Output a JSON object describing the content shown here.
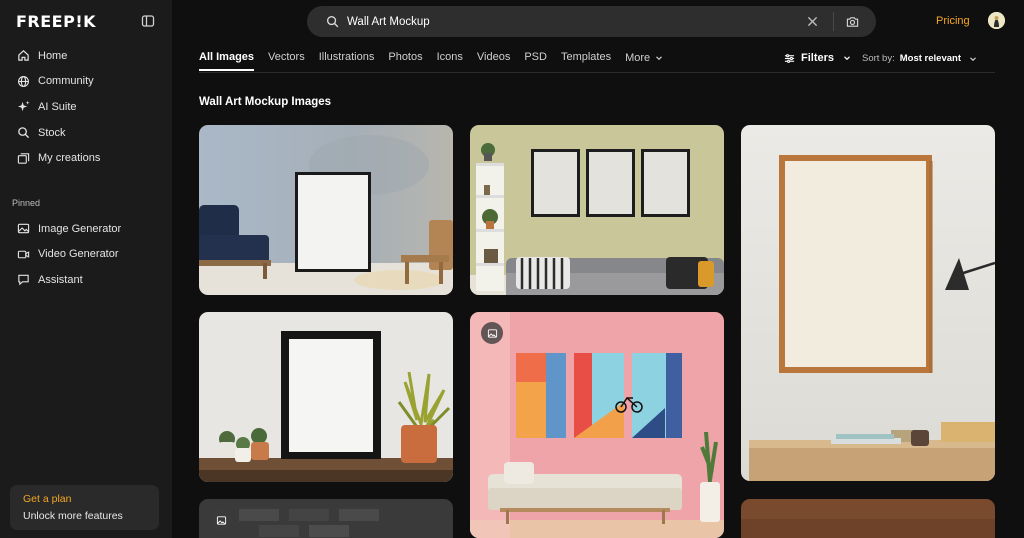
{
  "brand": {
    "logo_text": "FREEP!K"
  },
  "sidebar": {
    "items": [
      {
        "label": "Home",
        "icon": "home-icon"
      },
      {
        "label": "Community",
        "icon": "globe-icon"
      },
      {
        "label": "AI Suite",
        "icon": "sparkle-icon"
      },
      {
        "label": "Stock",
        "icon": "search-icon"
      },
      {
        "label": "My creations",
        "icon": "gallery-icon"
      }
    ],
    "pinned_label": "Pinned",
    "pinned": [
      {
        "label": "Image Generator",
        "icon": "image-icon"
      },
      {
        "label": "Video Generator",
        "icon": "video-icon"
      },
      {
        "label": "Assistant",
        "icon": "chat-icon"
      }
    ],
    "plan": {
      "title": "Get a plan",
      "subtitle": "Unlock more features"
    }
  },
  "header": {
    "search_value": "Wall Art Mockup",
    "pricing": "Pricing"
  },
  "tabs": [
    "All Images",
    "Vectors",
    "Illustrations",
    "Photos",
    "Icons",
    "Videos",
    "PSD",
    "Templates"
  ],
  "tabs_more": "More",
  "active_tab": "All Images",
  "toolbar": {
    "filters": "Filters",
    "sort_label": "Sort by:",
    "sort_value": "Most relevant"
  },
  "section_title": "Wall Art Mockup Images",
  "colors": {
    "accent": "#f5a623",
    "background": "#0f0f0f",
    "sidebar": "#1b1b1b"
  }
}
